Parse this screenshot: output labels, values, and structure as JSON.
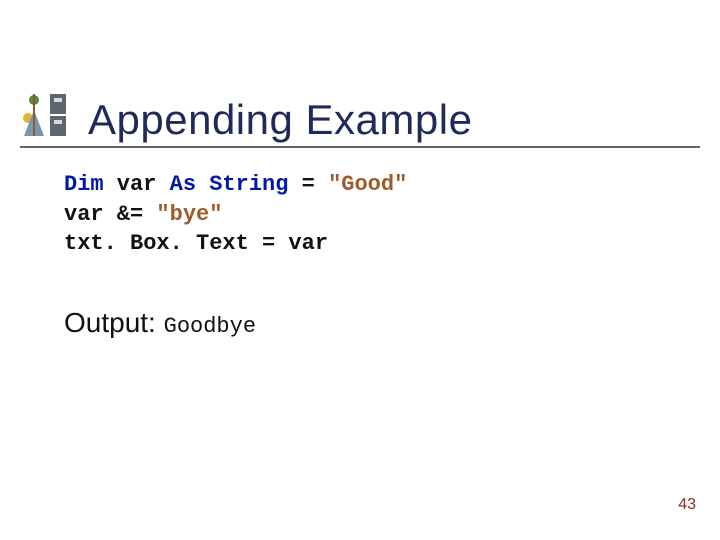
{
  "header": {
    "title": "Appending Example"
  },
  "code": {
    "line1": {
      "kw1": "Dim",
      "var": " var ",
      "kw2": "As",
      "sp": " ",
      "kw3": "String",
      "eq": " = ",
      "str": "\"Good\""
    },
    "line2": {
      "pre": "var &= ",
      "str": "\"bye\""
    },
    "line3": {
      "text": "txt. Box. Text = var"
    }
  },
  "output": {
    "label": "Output: ",
    "value": "Goodbye"
  },
  "page": {
    "number": "43"
  }
}
